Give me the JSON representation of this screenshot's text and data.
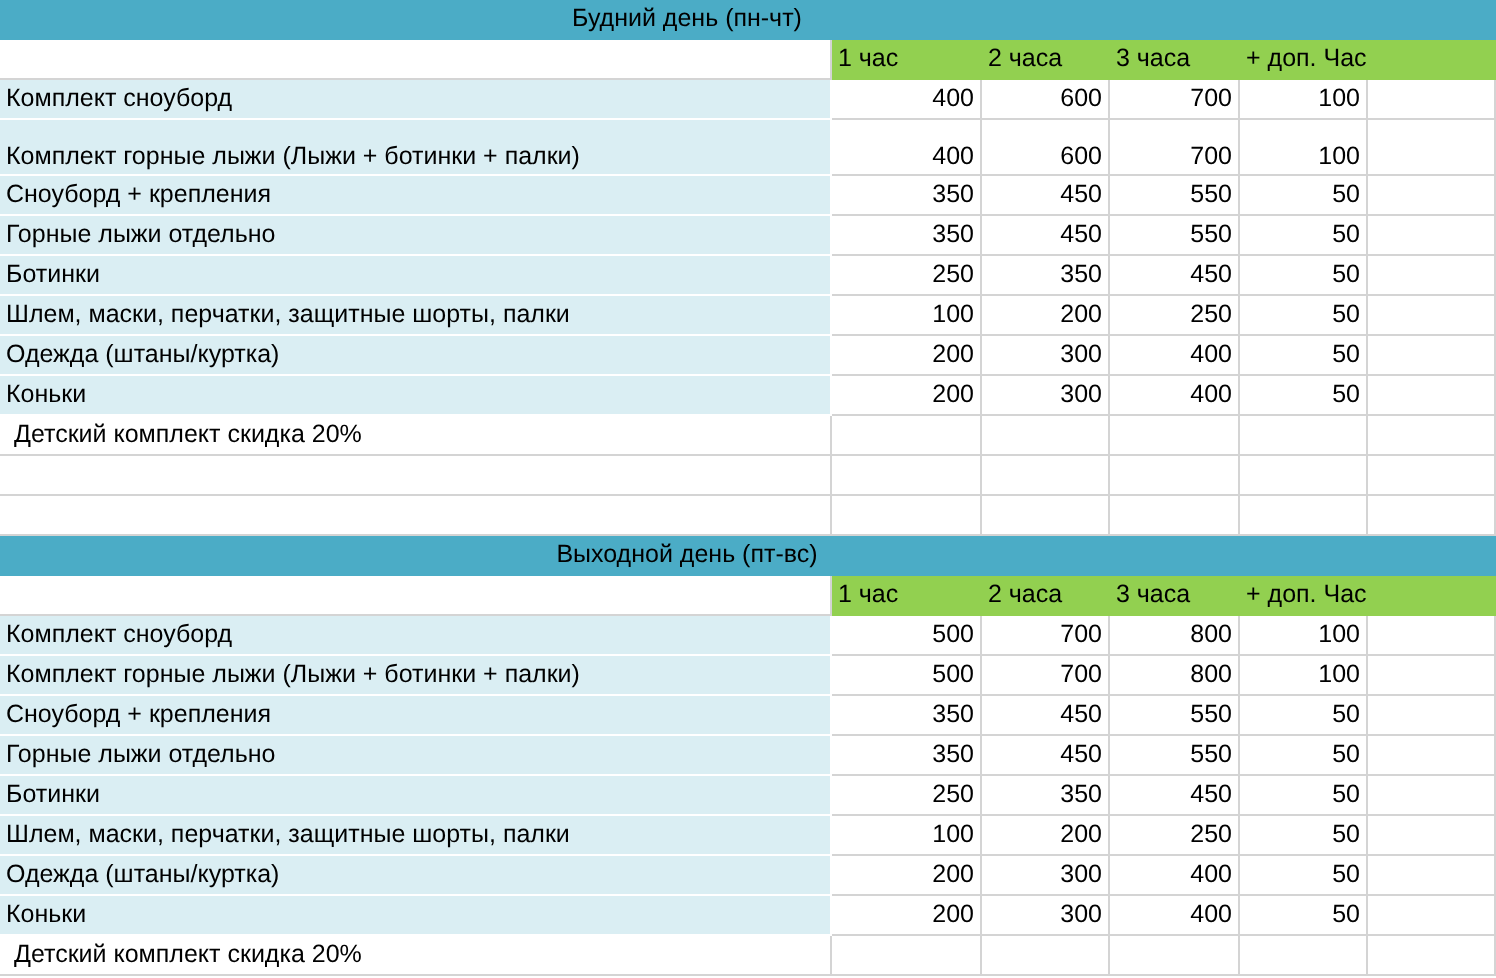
{
  "sections": [
    {
      "title": "Будний день (пн-чт)",
      "columns": [
        "1 час",
        "2 часа",
        "3 часа",
        "+ доп. Час"
      ],
      "rows": [
        {
          "name": "Комплект сноуборд",
          "tall": false,
          "values": [
            "400",
            "600",
            "700",
            "100"
          ]
        },
        {
          "name": "Комплект горные лыжи (Лыжи + ботинки + палки)",
          "tall": true,
          "values": [
            "400",
            "600",
            "700",
            "100"
          ]
        },
        {
          "name": "Сноуборд + крепления",
          "tall": false,
          "values": [
            "350",
            "450",
            "550",
            "50"
          ]
        },
        {
          "name": "Горные лыжи отдельно",
          "tall": false,
          "values": [
            "350",
            "450",
            "550",
            "50"
          ]
        },
        {
          "name": "Ботинки",
          "tall": false,
          "values": [
            "250",
            "350",
            "450",
            "50"
          ]
        },
        {
          "name": "Шлем, маски, перчатки, защитные шорты, палки",
          "tall": false,
          "values": [
            "100",
            "200",
            "250",
            "50"
          ]
        },
        {
          "name": "Одежда (штаны/куртка)",
          "tall": false,
          "values": [
            "200",
            "300",
            "400",
            "50"
          ]
        },
        {
          "name": "Коньки",
          "tall": false,
          "values": [
            "200",
            "300",
            "400",
            "50"
          ]
        }
      ],
      "note": "Детский комплект скидка 20%"
    },
    {
      "title": "Выходной день (пт-вс)",
      "columns": [
        "1 час",
        "2 часа",
        "3 часа",
        "+ доп. Час"
      ],
      "rows": [
        {
          "name": "Комплект сноуборд",
          "tall": false,
          "values": [
            "500",
            "700",
            "800",
            "100"
          ]
        },
        {
          "name": "Комплект горные лыжи (Лыжи + ботинки + палки)",
          "tall": false,
          "values": [
            "500",
            "700",
            "800",
            "100"
          ]
        },
        {
          "name": "Сноуборд + крепления",
          "tall": false,
          "values": [
            "350",
            "450",
            "550",
            "50"
          ]
        },
        {
          "name": "Горные лыжи отдельно",
          "tall": false,
          "values": [
            "350",
            "450",
            "550",
            "50"
          ]
        },
        {
          "name": "Ботинки",
          "tall": false,
          "values": [
            "250",
            "350",
            "450",
            "50"
          ]
        },
        {
          "name": "Шлем, маски, перчатки, защитные шорты, палки",
          "tall": false,
          "values": [
            "100",
            "200",
            "250",
            "50"
          ]
        },
        {
          "name": "Одежда (штаны/куртка)",
          "tall": false,
          "values": [
            "200",
            "300",
            "400",
            "50"
          ]
        },
        {
          "name": "Коньки",
          "tall": false,
          "values": [
            "200",
            "300",
            "400",
            "50"
          ]
        }
      ],
      "note": "Детский комплект скидка 20%"
    }
  ]
}
